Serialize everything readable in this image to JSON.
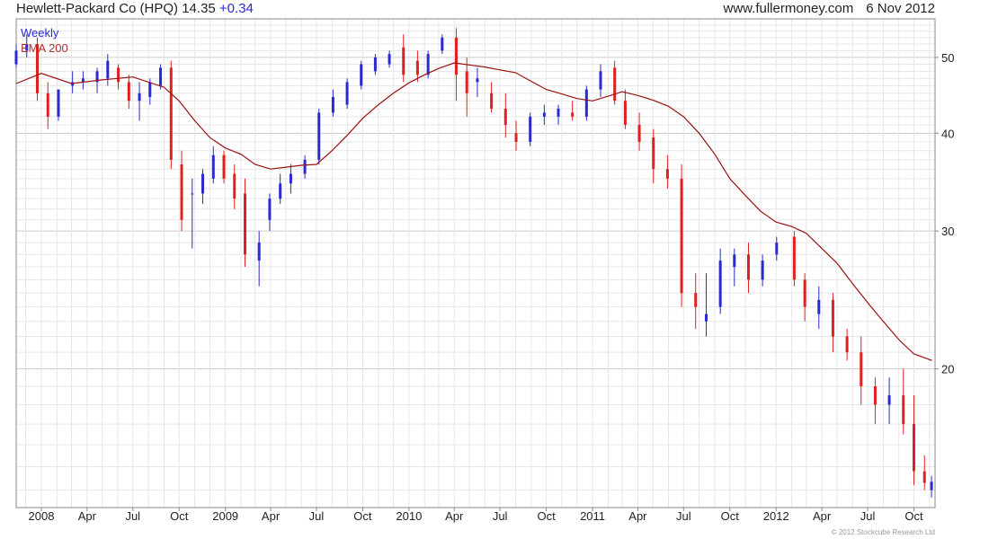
{
  "header": {
    "title": "Hewlett-Packard Co (HPQ) 14.35",
    "change": "+0.34",
    "site": "www.fullermoney.com",
    "date": "6 Nov 2012"
  },
  "credit": "© 2012 Stockcube Research Ltd",
  "colors": {
    "up": "#2a2ad0",
    "down": "#e02020",
    "ema": "#9a1010",
    "grid": "#e6e6e6",
    "grid_major": "#cccccc",
    "axis_text": "#222222"
  },
  "chart_data": {
    "type": "candlestick",
    "legend": [
      "Weekly",
      "EMA 200"
    ],
    "legend_position": "top-left",
    "grid": true,
    "y_axis_side": "right",
    "y_scale": "log",
    "ylim": [
      13.3,
      56
    ],
    "yticks": [
      20,
      30,
      40,
      50
    ],
    "xlim": [
      "2007-11-12",
      "2012-11-12"
    ],
    "xtick_dates": [
      "2008-01-01",
      "2008-04-01",
      "2008-07-01",
      "2008-10-01",
      "2009-01-01",
      "2009-04-01",
      "2009-07-01",
      "2009-10-01",
      "2010-01-01",
      "2010-04-01",
      "2010-07-01",
      "2010-10-01",
      "2011-01-01",
      "2011-04-01",
      "2011-07-01",
      "2011-10-01",
      "2012-01-01",
      "2012-04-01",
      "2012-07-01",
      "2012-10-01"
    ],
    "xtick_labels": [
      "2008",
      "Apr",
      "Jul",
      "Oct",
      "2009",
      "Apr",
      "Jul",
      "Oct",
      "2010",
      "Apr",
      "Jul",
      "Oct",
      "2011",
      "Apr",
      "Jul",
      "Oct",
      "2012",
      "Apr",
      "Jul",
      "Oct"
    ],
    "series": [
      {
        "name": "Weekly",
        "style": "candlestick",
        "x": [
          "2007-11-12",
          "2007-12-03",
          "2007-12-24",
          "2008-01-14",
          "2008-02-04",
          "2008-03-03",
          "2008-03-24",
          "2008-04-21",
          "2008-05-12",
          "2008-06-02",
          "2008-06-23",
          "2008-07-14",
          "2008-08-04",
          "2008-08-25",
          "2008-09-15",
          "2008-10-06",
          "2008-10-27",
          "2008-11-17",
          "2008-12-08",
          "2008-12-29",
          "2009-01-19",
          "2009-02-09",
          "2009-03-09",
          "2009-03-30",
          "2009-04-20",
          "2009-05-11",
          "2009-06-08",
          "2009-07-06",
          "2009-08-03",
          "2009-08-31",
          "2009-09-28",
          "2009-10-26",
          "2009-11-23",
          "2009-12-21",
          "2010-01-18",
          "2010-02-08",
          "2010-03-08",
          "2010-04-05",
          "2010-04-26",
          "2010-05-17",
          "2010-06-14",
          "2010-07-12",
          "2010-08-02",
          "2010-08-30",
          "2010-09-27",
          "2010-10-25",
          "2010-11-22",
          "2010-12-20",
          "2011-01-17",
          "2011-02-14",
          "2011-03-07",
          "2011-04-04",
          "2011-05-02",
          "2011-05-30",
          "2011-06-27",
          "2011-07-25",
          "2011-08-15",
          "2011-09-12",
          "2011-10-10",
          "2011-11-07",
          "2011-12-05",
          "2012-01-02",
          "2012-02-06",
          "2012-02-27",
          "2012-03-26",
          "2012-04-23",
          "2012-05-21",
          "2012-06-18",
          "2012-07-16",
          "2012-08-13",
          "2012-09-10",
          "2012-10-01",
          "2012-10-22",
          "2012-11-05"
        ],
        "open": [
          49.0,
          51.0,
          52.0,
          45.0,
          42.0,
          46.0,
          46.5,
          46.5,
          47.0,
          48.5,
          46.5,
          44.0,
          44.5,
          46.0,
          48.5,
          36.5,
          33.5,
          33.5,
          35.0,
          37.5,
          35.5,
          33.5,
          27.5,
          31.0,
          33.0,
          34.5,
          35.5,
          37.0,
          42.5,
          43.5,
          46.0,
          48.0,
          49.0,
          51.5,
          49.5,
          47.5,
          51.0,
          53.0,
          48.0,
          46.5,
          45.0,
          43.0,
          40.0,
          39.0,
          42.0,
          42.0,
          42.5,
          42.0,
          45.5,
          48.5,
          44.0,
          41.0,
          39.5,
          36.0,
          35.0,
          25.0,
          23.0,
          24.0,
          27.0,
          28.0,
          26.0,
          28.0,
          29.5,
          26.0,
          23.5,
          24.5,
          22.0,
          21.0,
          19.0,
          18.0,
          18.5,
          17.0,
          14.8,
          14.0
        ],
        "high": [
          52.0,
          53.5,
          53.0,
          46.5,
          45.5,
          48.0,
          48.0,
          48.5,
          50.5,
          49.0,
          47.5,
          46.5,
          47.0,
          49.0,
          49.5,
          38.0,
          35.0,
          36.0,
          38.5,
          38.0,
          36.5,
          35.0,
          30.0,
          33.5,
          35.5,
          36.5,
          37.5,
          43.0,
          45.5,
          47.0,
          49.5,
          50.5,
          51.0,
          53.5,
          51.0,
          51.0,
          53.5,
          54.5,
          50.0,
          48.5,
          46.5,
          45.0,
          41.5,
          42.5,
          43.5,
          43.5,
          44.0,
          46.0,
          49.0,
          49.5,
          45.5,
          42.5,
          40.5,
          37.5,
          36.5,
          26.5,
          26.5,
          28.5,
          28.5,
          29.0,
          28.0,
          29.5,
          30.0,
          26.5,
          25.5,
          25.0,
          22.5,
          22.0,
          19.5,
          19.5,
          20.0,
          18.5,
          15.5,
          14.6
        ],
        "low": [
          48.5,
          50.0,
          44.0,
          40.5,
          41.5,
          45.0,
          45.5,
          45.0,
          46.0,
          45.5,
          43.0,
          41.5,
          43.5,
          45.5,
          36.0,
          30.0,
          28.5,
          32.5,
          34.5,
          34.5,
          32.0,
          27.0,
          25.5,
          30.0,
          32.5,
          33.5,
          35.0,
          36.5,
          42.0,
          43.0,
          45.5,
          47.5,
          48.5,
          46.5,
          46.5,
          47.0,
          50.5,
          44.0,
          42.0,
          44.5,
          42.5,
          39.5,
          38.0,
          38.5,
          41.0,
          41.0,
          41.5,
          41.5,
          44.5,
          43.5,
          40.5,
          38.0,
          34.5,
          34.0,
          24.0,
          22.5,
          22.0,
          23.5,
          25.5,
          25.0,
          25.5,
          27.5,
          25.5,
          23.0,
          22.5,
          21.0,
          20.5,
          18.0,
          17.0,
          17.0,
          16.5,
          14.2,
          14.0,
          13.7
        ],
        "close": [
          51.0,
          52.0,
          45.0,
          42.0,
          45.5,
          46.5,
          47.0,
          48.0,
          49.5,
          46.5,
          44.0,
          45.0,
          46.5,
          48.5,
          37.0,
          31.0,
          33.5,
          35.5,
          37.5,
          35.0,
          33.0,
          28.0,
          29.0,
          33.0,
          34.5,
          35.5,
          37.0,
          42.5,
          44.5,
          46.5,
          49.0,
          50.0,
          50.5,
          47.5,
          47.5,
          50.5,
          53.0,
          47.5,
          45.0,
          47.0,
          43.0,
          41.0,
          39.0,
          42.0,
          42.5,
          43.0,
          42.0,
          45.5,
          48.0,
          44.0,
          41.0,
          39.0,
          36.0,
          35.0,
          25.0,
          24.0,
          23.5,
          27.5,
          28.0,
          26.0,
          27.5,
          29.0,
          26.0,
          24.0,
          24.5,
          22.0,
          21.0,
          19.0,
          18.0,
          18.5,
          17.0,
          14.8,
          14.3,
          14.35
        ]
      },
      {
        "name": "EMA 200",
        "style": "line",
        "x": [
          "2007-11-12",
          "2008-01-01",
          "2008-03-01",
          "2008-05-01",
          "2008-07-01",
          "2008-09-01",
          "2008-10-01",
          "2008-11-01",
          "2008-12-01",
          "2009-01-01",
          "2009-02-01",
          "2009-03-01",
          "2009-04-01",
          "2009-05-01",
          "2009-06-01",
          "2009-07-01",
          "2009-08-01",
          "2009-09-01",
          "2009-10-01",
          "2009-11-01",
          "2009-12-01",
          "2010-01-01",
          "2010-02-01",
          "2010-03-01",
          "2010-04-01",
          "2010-05-01",
          "2010-06-01",
          "2010-07-01",
          "2010-08-01",
          "2010-09-01",
          "2010-10-01",
          "2010-11-01",
          "2010-12-01",
          "2011-01-01",
          "2011-02-01",
          "2011-03-01",
          "2011-04-01",
          "2011-05-01",
          "2011-06-01",
          "2011-07-01",
          "2011-08-01",
          "2011-09-01",
          "2011-10-01",
          "2011-11-01",
          "2011-12-01",
          "2012-01-01",
          "2012-02-01",
          "2012-03-01",
          "2012-04-01",
          "2012-05-01",
          "2012-06-01",
          "2012-07-01",
          "2012-08-01",
          "2012-09-01",
          "2012-10-01",
          "2012-11-06"
        ],
        "values": [
          46.3,
          47.7,
          46.3,
          46.8,
          47.2,
          45.8,
          44.0,
          41.5,
          39.5,
          38.3,
          37.6,
          36.5,
          36.0,
          36.2,
          36.4,
          36.5,
          38.0,
          39.8,
          41.8,
          43.5,
          45.0,
          46.4,
          47.5,
          48.4,
          49.2,
          48.9,
          48.6,
          48.2,
          47.8,
          46.6,
          45.5,
          44.9,
          44.3,
          44.0,
          44.6,
          45.2,
          44.7,
          44.1,
          43.3,
          42.0,
          40.0,
          37.6,
          35.0,
          33.3,
          31.8,
          30.8,
          30.4,
          29.8,
          28.5,
          27.3,
          25.7,
          24.3,
          23.0,
          21.8,
          20.9,
          20.5
        ]
      }
    ]
  }
}
